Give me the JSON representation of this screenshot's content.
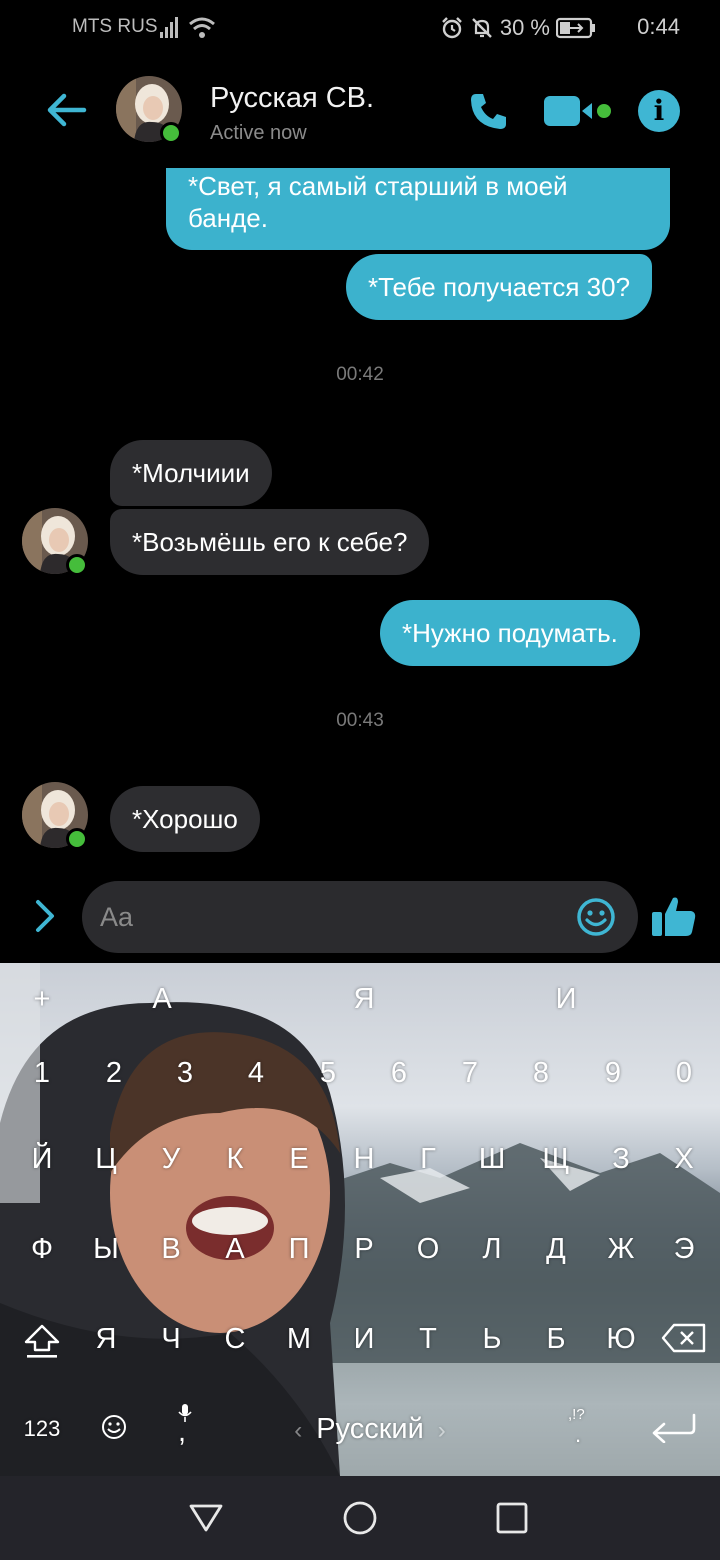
{
  "status_bar": {
    "carrier": "MTS RUS",
    "battery": "30 %",
    "time": "0:44"
  },
  "header": {
    "contact_name": "Русская СВ.",
    "presence": "Active now",
    "accent": "#3fb6d3",
    "online_color": "#45bd3b"
  },
  "messages": [
    {
      "side": "outgoing",
      "text": "*Свет, я самый старший в моей банде."
    },
    {
      "side": "outgoing",
      "text": "*Тебе получается 30?"
    },
    {
      "side": "separator",
      "text": "00:42"
    },
    {
      "side": "incoming",
      "text": "*Молчиии"
    },
    {
      "side": "incoming",
      "text": "*Возьмёшь его к себе?"
    },
    {
      "side": "outgoing",
      "text": "*Нужно подумать."
    },
    {
      "side": "separator",
      "text": "00:43"
    },
    {
      "side": "incoming",
      "text": "*Хорошо"
    }
  ],
  "composer": {
    "placeholder": "Aa"
  },
  "keyboard": {
    "suggestions": [
      "+",
      "А",
      "Я",
      "И"
    ],
    "number_row": [
      "1",
      "2",
      "3",
      "4",
      "5",
      "6",
      "7",
      "8",
      "9",
      "0"
    ],
    "row1": [
      "Й",
      "Ц",
      "У",
      "К",
      "Е",
      "Н",
      "Г",
      "Ш",
      "Щ",
      "З",
      "Х"
    ],
    "row2": [
      "Ф",
      "Ы",
      "В",
      "А",
      "П",
      "Р",
      "О",
      "Л",
      "Д",
      "Ж",
      "Э"
    ],
    "row3": [
      "Я",
      "Ч",
      "С",
      "М",
      "И",
      "Т",
      "Ь",
      "Б",
      "Ю"
    ],
    "symbols_key": "123",
    "comma_key": ",",
    "space_label": "Русский",
    "punct_top": ",!?",
    "punct_bottom": "."
  }
}
